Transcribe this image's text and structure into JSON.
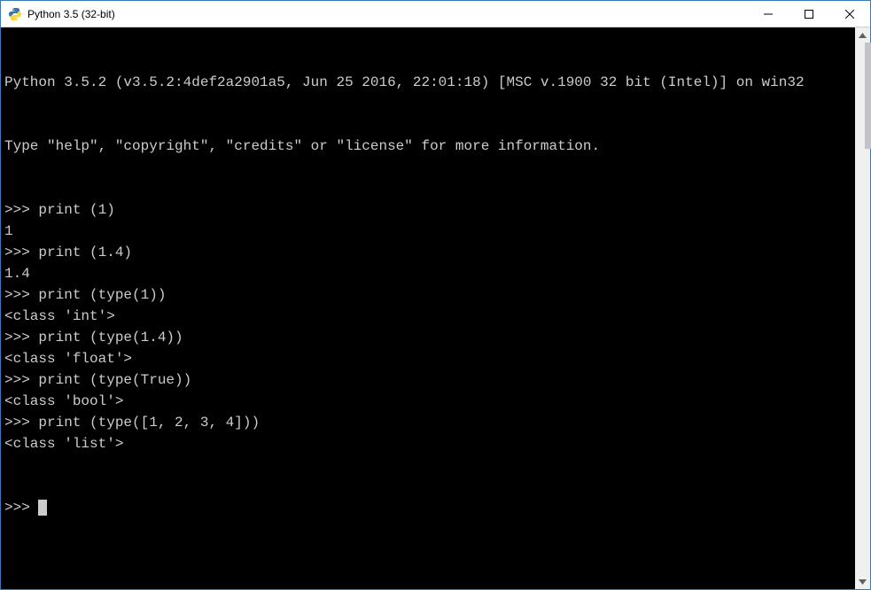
{
  "window": {
    "title": "Python 3.5 (32-bit)"
  },
  "console": {
    "header1": "Python 3.5.2 (v3.5.2:4def2a2901a5, Jun 25 2016, 22:01:18) [MSC v.1900 32 bit (Intel)] on win32",
    "header2": "Type \"help\", \"copyright\", \"credits\" or \"license\" for more information.",
    "lines": [
      {
        "prompt": ">>> ",
        "text": "print (1)"
      },
      {
        "prompt": "",
        "text": "1"
      },
      {
        "prompt": ">>> ",
        "text": "print (1.4)"
      },
      {
        "prompt": "",
        "text": "1.4"
      },
      {
        "prompt": ">>> ",
        "text": "print (type(1))"
      },
      {
        "prompt": "",
        "text": "<class 'int'>"
      },
      {
        "prompt": ">>> ",
        "text": "print (type(1.4))"
      },
      {
        "prompt": "",
        "text": "<class 'float'>"
      },
      {
        "prompt": ">>> ",
        "text": "print (type(True))"
      },
      {
        "prompt": "",
        "text": "<class 'bool'>"
      },
      {
        "prompt": ">>> ",
        "text": "print (type([1, 2, 3, 4]))"
      },
      {
        "prompt": "",
        "text": "<class 'list'>"
      }
    ],
    "cursor_prompt": ">>> "
  }
}
